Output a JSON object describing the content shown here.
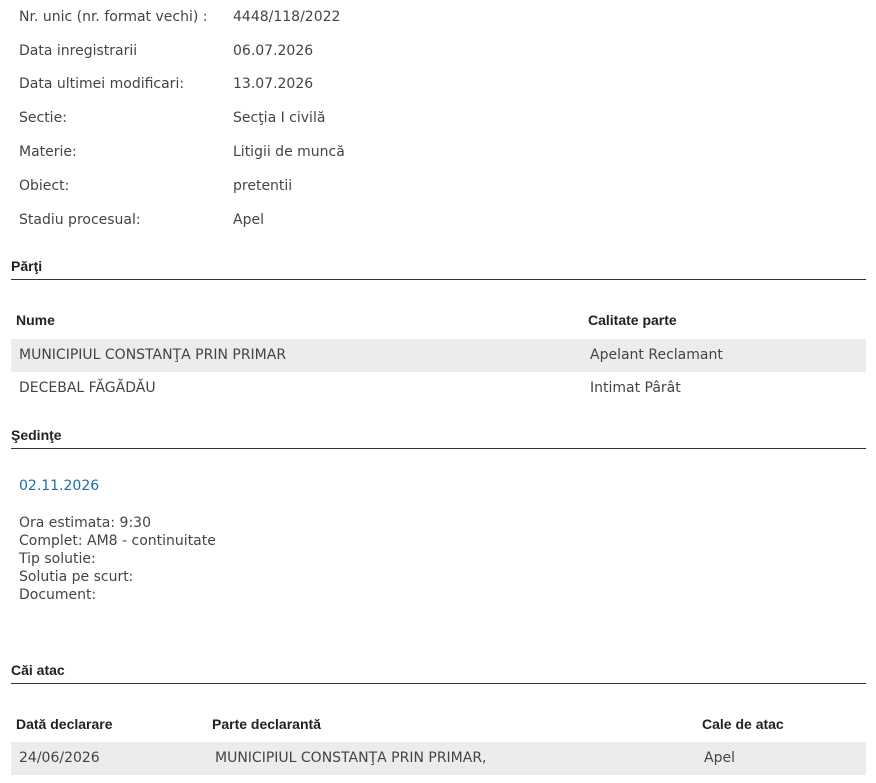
{
  "case_info": [
    {
      "label": "Nr. unic (nr. format vechi) :",
      "value": "4448/118/2022"
    },
    {
      "label": "Data inregistrarii",
      "value": "06.07.2026"
    },
    {
      "label": "Data ultimei modificari:",
      "value": "13.07.2026"
    },
    {
      "label": "Sectie:",
      "value": "Secţia I civilă"
    },
    {
      "label": "Materie:",
      "value": "Litigii de muncă"
    },
    {
      "label": "Obiect:",
      "value": "pretentii"
    },
    {
      "label": "Stadiu procesual:",
      "value": "Apel"
    }
  ],
  "parti": {
    "title": "Părţi",
    "headers": {
      "nume": "Nume",
      "calitate": "Calitate parte"
    },
    "rows": [
      {
        "nume": "MUNICIPIUL CONSTANŢA PRIN PRIMAR",
        "calitate": "Apelant Reclamant"
      },
      {
        "nume": "DECEBAL FĂGĂDĂU",
        "calitate": "Intimat Pârât"
      }
    ]
  },
  "sedinte": {
    "title": "Şedinţe",
    "date": "02.11.2026",
    "details": [
      "Ora estimata: 9:30",
      "Complet: AM8 - continuitate",
      "Tip solutie:",
      "Solutia pe scurt:",
      "Document:"
    ]
  },
  "cai_atac": {
    "title": "Căi atac",
    "headers": {
      "data": "Dată declarare",
      "parte": "Parte declarantă",
      "cale": "Cale de atac"
    },
    "rows": [
      {
        "data": "24/06/2026",
        "parte": "MUNICIPIUL CONSTANŢA PRIN PRIMAR,",
        "cale": "Apel"
      }
    ]
  },
  "colors": {
    "link": "#1c6ea4",
    "row_shade": "#ececec",
    "text": "#444444"
  }
}
